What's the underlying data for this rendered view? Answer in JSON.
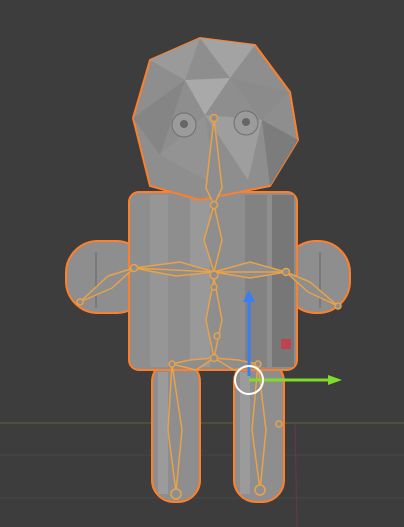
{
  "scene": {
    "background_color": "#3d3d3d",
    "grid_color": "#474747",
    "mesh_fill": "#8e8e8e",
    "mesh_shade": "#7a7a7a",
    "mesh_light": "#a9a9a9",
    "selection_outline": "#ff7f2a",
    "armature_color": "#e8a24a",
    "gizmo_x_color": "#7fdc2a",
    "gizmo_z_color": "#3a7ff0",
    "gizmo_y_color": "#c0424a"
  },
  "objects": [
    {
      "name": "robot-head-mesh",
      "selected": true
    },
    {
      "name": "robot-body-mesh",
      "selected": true
    },
    {
      "name": "armature",
      "selected": true
    }
  ],
  "gizmo": {
    "axes": [
      "x",
      "y",
      "z"
    ]
  }
}
